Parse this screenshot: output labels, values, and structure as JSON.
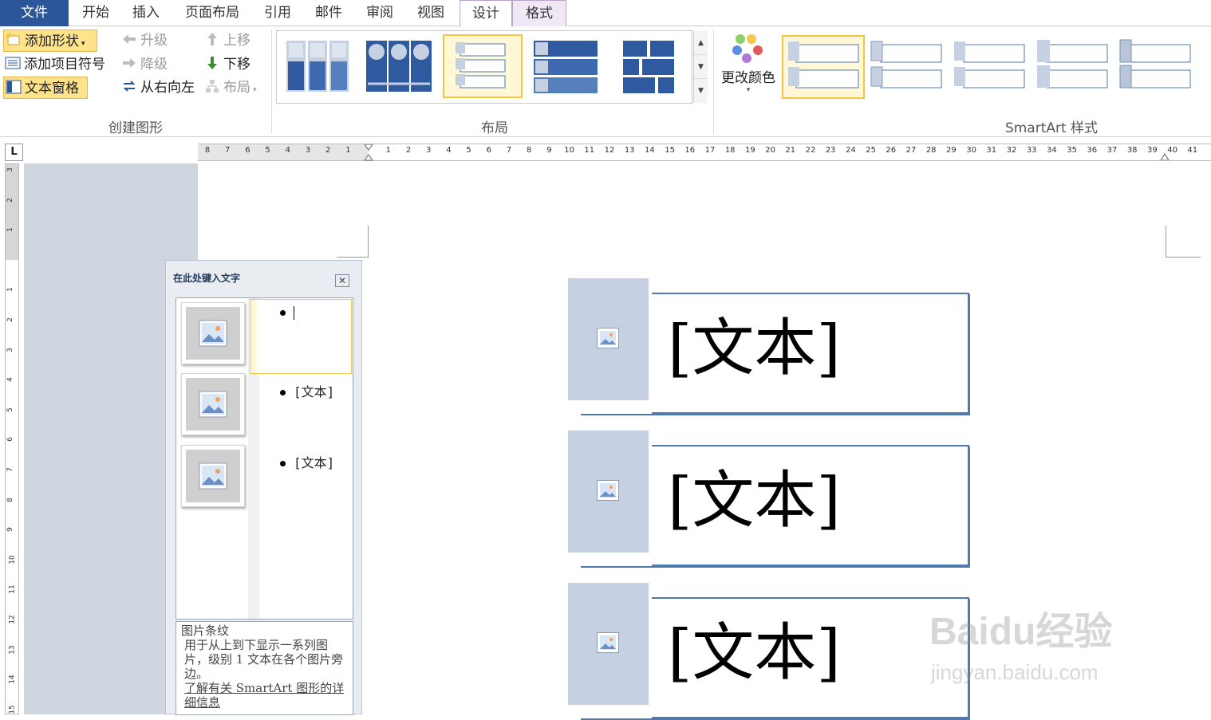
{
  "tabs": {
    "file": "文件",
    "home": "开始",
    "insert": "插入",
    "page_layout": "页面布局",
    "references": "引用",
    "mailings": "邮件",
    "review": "审阅",
    "view": "视图",
    "design": "设计",
    "format": "格式"
  },
  "ribbon": {
    "create_graphic": {
      "add_shape": "添加形状",
      "add_bullet": "添加项目符号",
      "text_pane": "文本窗格",
      "promote": "升级",
      "demote": "降级",
      "right_to_left": "从右向左",
      "move_up": "上移",
      "move_down": "下移",
      "layout": "布局",
      "label": "创建图形"
    },
    "layouts_label": "布局",
    "change_colors": "更改颜色",
    "styles_label": "SmartArt 样式"
  },
  "ruler": {
    "corner": "L",
    "h_ticks": [
      "8",
      "7",
      "6",
      "5",
      "4",
      "3",
      "2",
      "1",
      "",
      "1",
      "2",
      "3",
      "4",
      "5",
      "6",
      "7",
      "8",
      "9",
      "10",
      "11",
      "12",
      "13",
      "14",
      "15",
      "16",
      "17",
      "18",
      "19",
      "20",
      "21",
      "22",
      "23",
      "24",
      "25",
      "26",
      "27",
      "28",
      "29",
      "30",
      "31",
      "32",
      "33",
      "34",
      "35",
      "36",
      "37",
      "38",
      "39",
      "40",
      "41"
    ],
    "v_ticks": [
      "3",
      "2",
      "1",
      "",
      "1",
      "2",
      "3",
      "4",
      "5",
      "6",
      "7",
      "8",
      "9",
      "10",
      "11",
      "12",
      "13",
      "14",
      "15"
    ]
  },
  "text_pane": {
    "title": "在此处键入文字",
    "items": [
      "",
      "[文本]",
      "[文本]"
    ],
    "desc_title": "图片条纹",
    "desc_body": "用于从上到下显示一系列图片，级别 1 文本在各个图片旁边。",
    "learn_more": "了解有关 SmartArt 图形的详细信息"
  },
  "smartart": {
    "items": [
      "[文本]",
      "[文本]",
      "[文本]"
    ]
  },
  "watermark": {
    "brand": "Baidu经验",
    "url": "jingyan.baidu.com"
  },
  "colors": {
    "file_tab": "#2b579a",
    "selection": "#ffe38a",
    "picture_fill": "#c5d0e3",
    "frame_border": "#4f7ab0"
  }
}
